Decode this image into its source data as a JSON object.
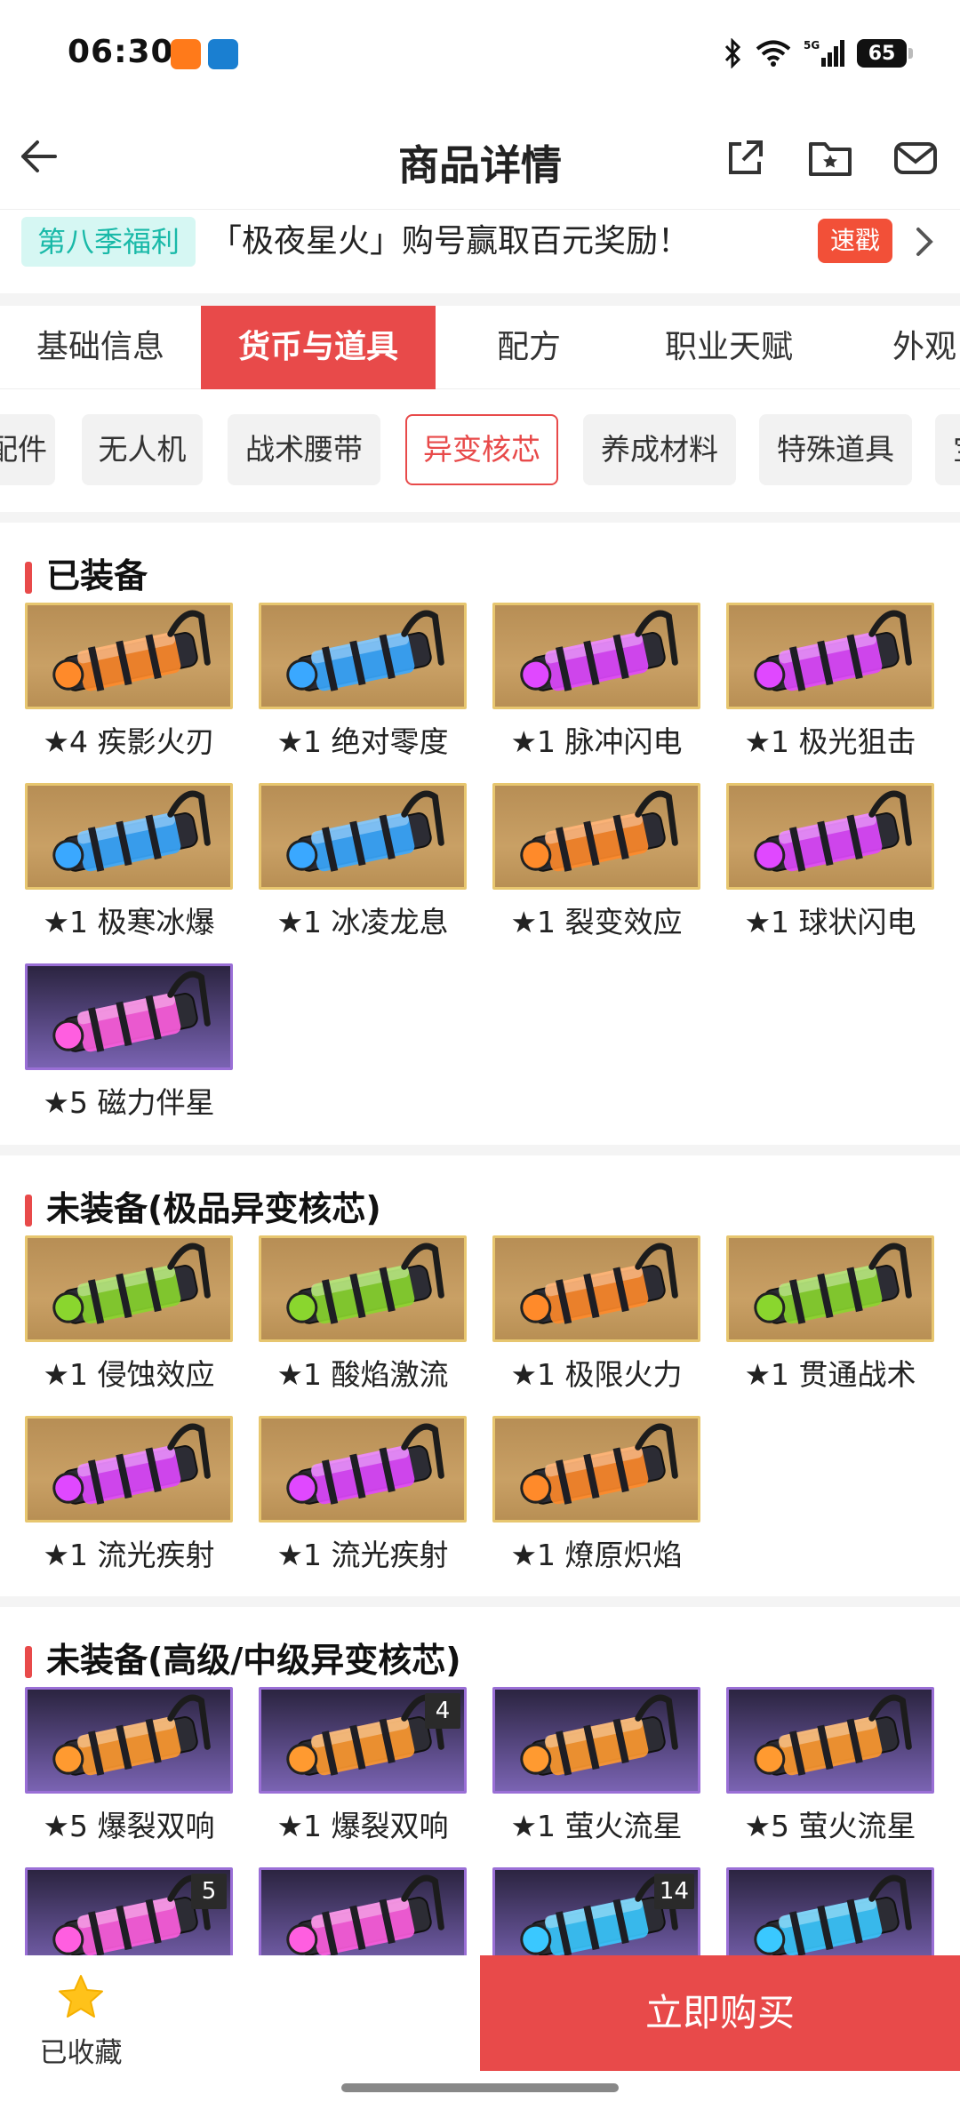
{
  "status": {
    "time": "06:30",
    "battery": "65"
  },
  "header": {
    "title": "商品详情"
  },
  "promo": {
    "tag": "第八季福利",
    "text": "「极夜星火」购号赢取百元奖励！",
    "badge": "速戳"
  },
  "tabs": [
    {
      "label": "基础信息"
    },
    {
      "label": "货币与道具",
      "active": true
    },
    {
      "label": "配方"
    },
    {
      "label": "职业天赋"
    },
    {
      "label": "外观"
    }
  ],
  "chips": [
    {
      "label": "配件"
    },
    {
      "label": "无人机"
    },
    {
      "label": "战术腰带"
    },
    {
      "label": "异变核芯",
      "active": true
    },
    {
      "label": "养成材料"
    },
    {
      "label": "特殊道具"
    },
    {
      "label": "宝"
    }
  ],
  "sections": [
    {
      "title": "已装备",
      "items": [
        {
          "label": "★4 疾影火刃",
          "frame": "gold",
          "color": "#ff8a2a"
        },
        {
          "label": "★1 绝对零度",
          "frame": "gold",
          "color": "#3aa8ff"
        },
        {
          "label": "★1 脉冲闪电",
          "frame": "gold",
          "color": "#e048ff"
        },
        {
          "label": "★1 极光狙击",
          "frame": "gold",
          "color": "#e048ff"
        },
        {
          "label": "★1 极寒冰爆",
          "frame": "gold",
          "color": "#3aa8ff"
        },
        {
          "label": "★1 冰凌龙息",
          "frame": "gold",
          "color": "#3aa8ff"
        },
        {
          "label": "★1 裂变效应",
          "frame": "gold",
          "color": "#ff8a2a"
        },
        {
          "label": "★1 球状闪电",
          "frame": "gold",
          "color": "#e048ff"
        },
        {
          "label": "★5 磁力伴星",
          "frame": "purple",
          "color": "#ff5ee0"
        }
      ]
    },
    {
      "title": "未装备(极品异变核芯)",
      "items": [
        {
          "label": "★1 侵蚀效应",
          "frame": "gold",
          "color": "#8ad62e"
        },
        {
          "label": "★1 酸焰激流",
          "frame": "gold",
          "color": "#8ad62e"
        },
        {
          "label": "★1 极限火力",
          "frame": "gold",
          "color": "#ff8a2a"
        },
        {
          "label": "★1 贯通战术",
          "frame": "gold",
          "color": "#8ad62e"
        },
        {
          "label": "★1 流光疾射",
          "frame": "gold",
          "color": "#e048ff"
        },
        {
          "label": "★1 流光疾射",
          "frame": "gold",
          "color": "#e048ff"
        },
        {
          "label": "★1 燎原炽焰",
          "frame": "gold",
          "color": "#ff8a2a"
        }
      ]
    },
    {
      "title": "未装备(高级/中级异变核芯)",
      "items": [
        {
          "label": "★5 爆裂双响",
          "frame": "purple",
          "color": "#ff9a30"
        },
        {
          "label": "★1 爆裂双响",
          "frame": "purple",
          "color": "#ff9a30",
          "qty": "4"
        },
        {
          "label": "★1 萤火流星",
          "frame": "purple",
          "color": "#ff9a30"
        },
        {
          "label": "★5 萤火流星",
          "frame": "purple",
          "color": "#ff9a30"
        },
        {
          "label": "",
          "frame": "purple",
          "color": "#ff5ee0",
          "qty": "5"
        },
        {
          "label": "",
          "frame": "purple",
          "color": "#ff5ee0"
        },
        {
          "label": "",
          "frame": "purple",
          "color": "#3ac8ff",
          "qty": "14"
        },
        {
          "label": "",
          "frame": "purple",
          "color": "#3ac8ff"
        }
      ]
    }
  ],
  "bottom": {
    "fav_label": "已收藏",
    "buy_label": "立即购买"
  },
  "colors": {
    "accent": "#e84a4a",
    "promo_tag_bg": "#d6f7f3",
    "promo_tag_fg": "#19b9a8"
  }
}
